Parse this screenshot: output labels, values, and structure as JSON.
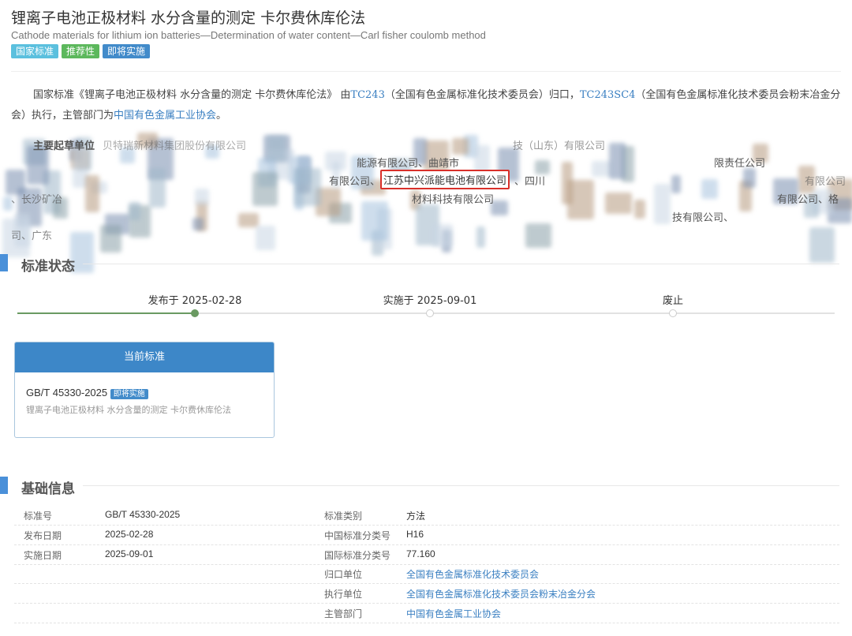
{
  "header": {
    "title": "锂离子电池正极材料 水分含量的测定 卡尔费休库伦法",
    "subtitle": "Cathode materials for lithium ion batteries—Determination of water content—Carl fisher coulomb method",
    "tags": [
      {
        "label": "国家标准",
        "color": "#5bc0de"
      },
      {
        "label": "推荐性",
        "color": "#5cb85c"
      },
      {
        "label": "即将实施",
        "color": "#428bca"
      }
    ]
  },
  "intro": {
    "p1": "国家标准《锂离子电池正极材料 水分含量的测定 卡尔费休库伦法》 由",
    "tc1": "TC243",
    "p2": "（全国有色金属标准化技术委员会）归口，",
    "tc2": "TC243SC4",
    "p3": "（全国有色金属标准化技术委员会粉末冶金分会）执行，主管部门为",
    "dept": "中国有色金属工业协会",
    "p4": "。"
  },
  "drafters": {
    "lead": "主要起草单位",
    "fragments": [
      "贝特瑞新材料集团股份有限公司",
      "技（山东）有限公司",
      "能源有限公司、曲靖市",
      "限责任公司",
      "有限公司、",
      "江苏中兴派能电池有限公司",
      "、四川",
      "有限公司",
      "、长沙矿冶",
      "材料科技有限公司",
      "有限公司、格",
      "技有限公司、",
      "司、广东"
    ],
    "highlighted": "江苏中兴派能电池有限公司"
  },
  "status": {
    "title": "标准状态",
    "steps": [
      {
        "label": "发布于 2025-02-28",
        "done": true
      },
      {
        "label": "实施于 2025-09-01",
        "done": false
      },
      {
        "label": "废止",
        "done": false
      }
    ],
    "progress_color": "#6a9a62"
  },
  "current": {
    "header": "当前标准",
    "code": "GB/T 45330-2025",
    "badge": "即将实施",
    "name": "锂离子电池正极材料 水分含量的测定 卡尔费休库伦法"
  },
  "basic": {
    "title": "基础信息",
    "rows": [
      {
        "l1": "标准号",
        "v1": "GB/T 45330-2025",
        "l2": "标准类别",
        "v2": "方法"
      },
      {
        "l1": "发布日期",
        "v1": "2025-02-28",
        "l2": "中国标准分类号",
        "v2": "H16"
      },
      {
        "l1": "实施日期",
        "v1": "2025-09-01",
        "l2": "国际标准分类号",
        "v2": "77.160"
      },
      {
        "l1": "",
        "v1": "",
        "l2": "归口单位",
        "v2": "全国有色金属标准化技术委员会"
      },
      {
        "l1": "",
        "v1": "",
        "l2": "执行单位",
        "v2": "全国有色金属标准化技术委员会粉末冶金分会"
      },
      {
        "l1": "",
        "v1": "",
        "l2": "主管部门",
        "v2": "中国有色金属工业协会"
      }
    ]
  }
}
